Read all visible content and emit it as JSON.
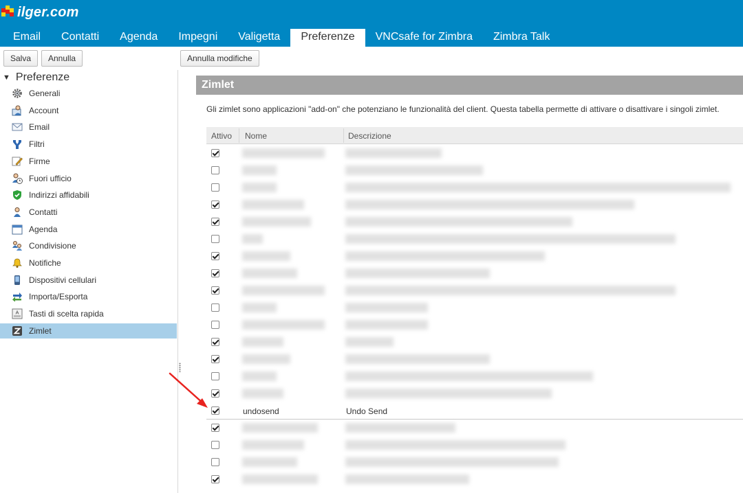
{
  "header": {
    "logo_text": "ilger.com",
    "logo_alt": "zimbra-logo-mark",
    "tabs": [
      {
        "label": "Email",
        "active": false
      },
      {
        "label": "Contatti",
        "active": false
      },
      {
        "label": "Agenda",
        "active": false
      },
      {
        "label": "Impegni",
        "active": false
      },
      {
        "label": "Valigetta",
        "active": false
      },
      {
        "label": "Preferenze",
        "active": true
      },
      {
        "label": "VNCsafe for Zimbra",
        "active": false
      },
      {
        "label": "Zimbra Talk",
        "active": false
      }
    ]
  },
  "toolbar": {
    "save_label": "Salva",
    "cancel_label": "Annulla",
    "undo_label": "Annulla modifiche"
  },
  "sidebar": {
    "title": "Preferenze",
    "items": [
      {
        "label": "Generali",
        "icon": "gear-icon"
      },
      {
        "label": "Account",
        "icon": "account-icon"
      },
      {
        "label": "Email",
        "icon": "envelope-icon"
      },
      {
        "label": "Filtri",
        "icon": "filter-icon"
      },
      {
        "label": "Firme",
        "icon": "signature-icon"
      },
      {
        "label": "Fuori ufficio",
        "icon": "out-of-office-icon"
      },
      {
        "label": "Indirizzi affidabili",
        "icon": "shield-check-icon"
      },
      {
        "label": "Contatti",
        "icon": "contact-icon"
      },
      {
        "label": "Agenda",
        "icon": "calendar-icon"
      },
      {
        "label": "Condivisione",
        "icon": "sharing-icon"
      },
      {
        "label": "Notifiche",
        "icon": "bell-icon"
      },
      {
        "label": "Dispositivi cellulari",
        "icon": "mobile-icon"
      },
      {
        "label": "Importa/Esporta",
        "icon": "import-export-icon"
      },
      {
        "label": "Tasti di scelta rapida",
        "icon": "keyboard-shortcut-icon"
      },
      {
        "label": "Zimlet",
        "icon": "zimlet-icon",
        "active": true
      }
    ]
  },
  "content": {
    "section_title": "Zimlet",
    "description": "Gli zimlet sono applicazioni \"add-on\" che potenziano le funzionalità del client. Questa tabella permette di attivare o disattivare i singoli zimlet.",
    "columns": {
      "active": "Attivo",
      "name": "Nome",
      "description": "Descrizione"
    },
    "rows": [
      {
        "checked": true
      },
      {
        "checked": false
      },
      {
        "checked": false
      },
      {
        "checked": true
      },
      {
        "checked": true
      },
      {
        "checked": false
      },
      {
        "checked": true
      },
      {
        "checked": true
      },
      {
        "checked": true
      },
      {
        "checked": false
      },
      {
        "checked": false
      },
      {
        "checked": true
      },
      {
        "checked": true
      },
      {
        "checked": false
      },
      {
        "checked": true
      },
      {
        "checked": true,
        "name": "undosend",
        "description": "Undo Send"
      },
      {
        "checked": true
      },
      {
        "checked": false
      },
      {
        "checked": false
      },
      {
        "checked": true
      }
    ]
  },
  "colors": {
    "header_bg": "#0087c3",
    "active_nav_bg": "#a7cfe9",
    "section_bar_bg": "#a3a3a3",
    "annotation_arrow": "#e8231f"
  }
}
